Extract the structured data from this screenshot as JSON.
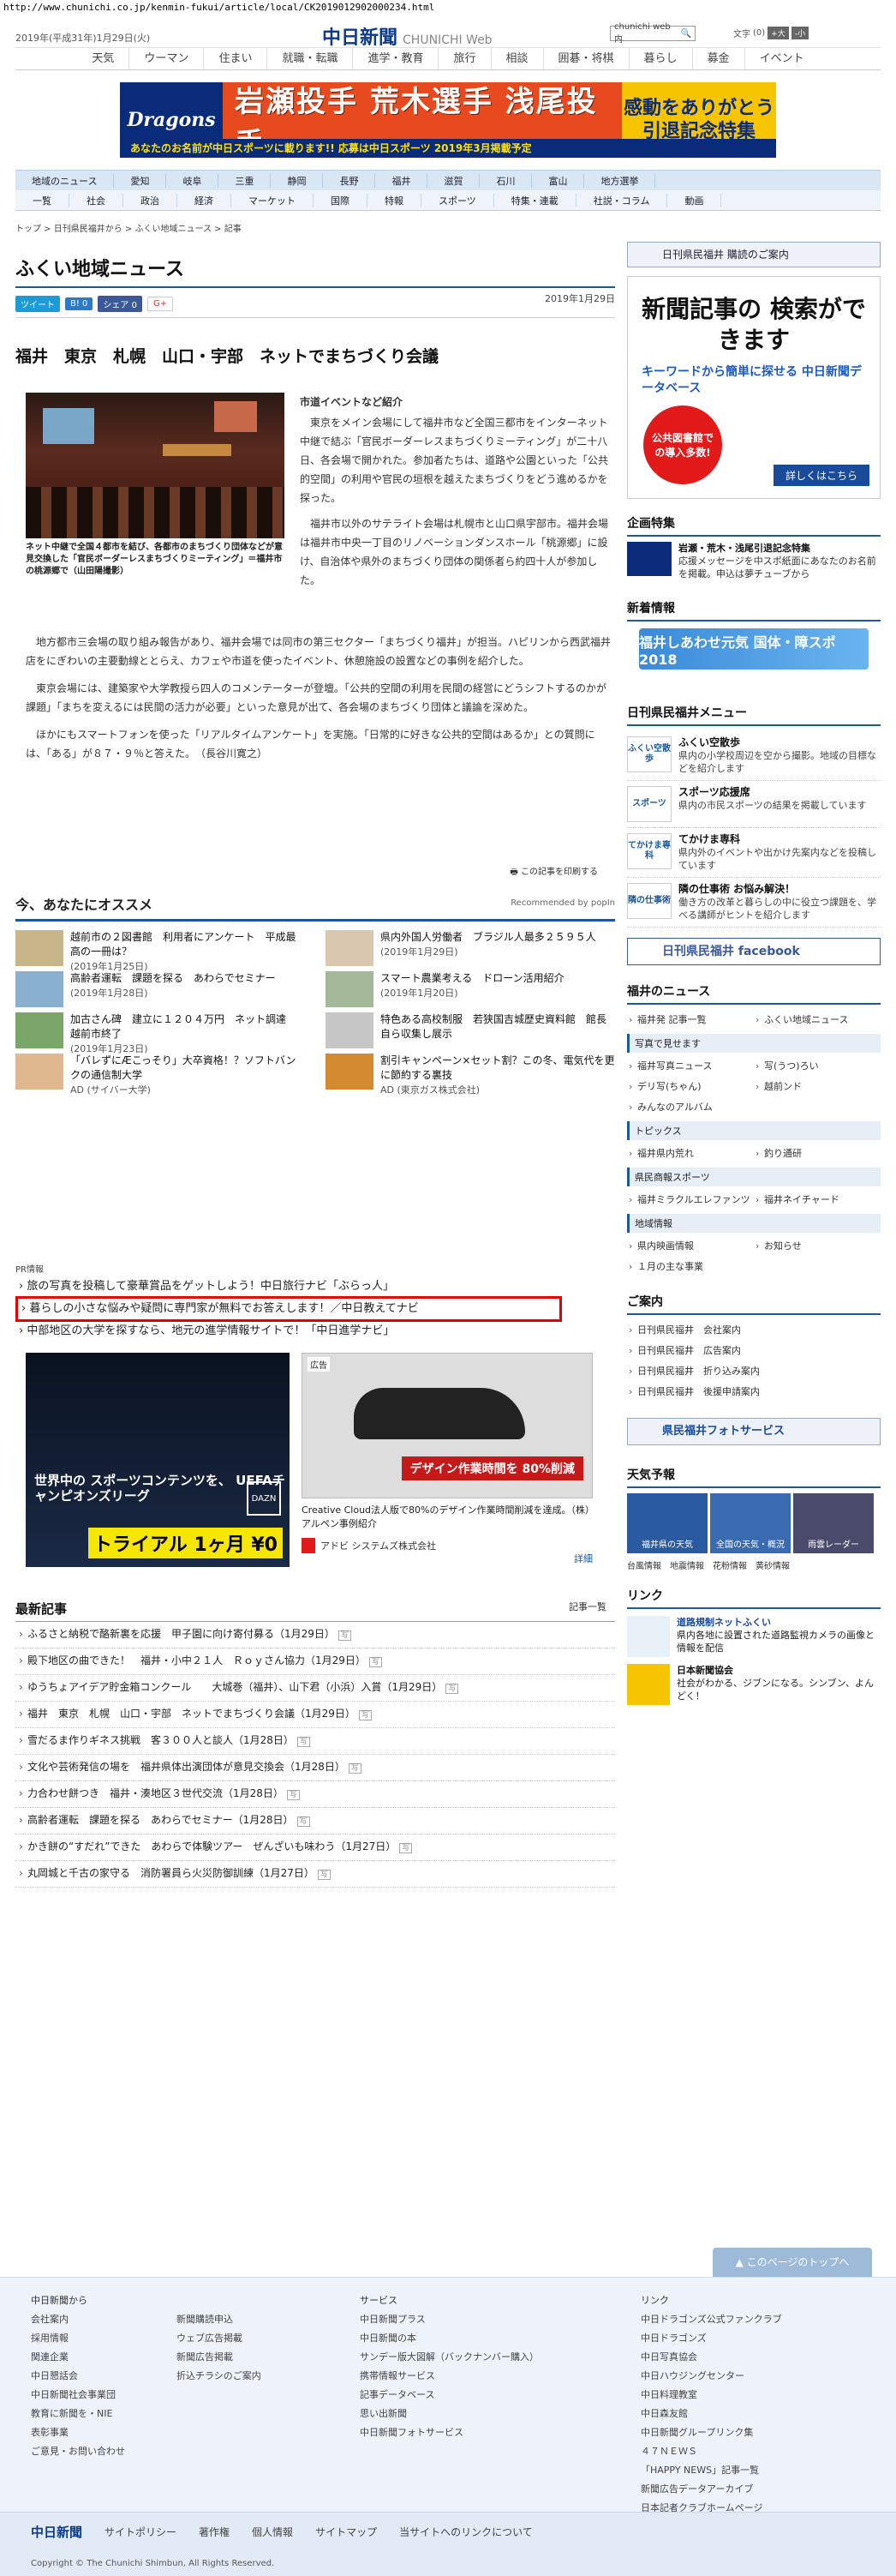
{
  "url": "http://www.chunichi.co.jp/kenmin-fukui/article/local/CK2019012902000234.html",
  "header": {
    "date": "2019年(平成31年)1月29日(火)",
    "logo": "中日新聞",
    "logo_web": "CHUNICHI Web",
    "search_placeholder": "chunichi web 内",
    "search_btn": "🔍",
    "font_label": "文字",
    "font_size": "(0)",
    "font_plus": "+大",
    "font_minus": "-小"
  },
  "gnav": [
    "天気",
    "ウーマン",
    "住まい",
    "就職・転職",
    "進学・教育",
    "旅行",
    "相談",
    "囲碁・将棋",
    "暮らし",
    "募金",
    "イベント"
  ],
  "banner": {
    "logo": "Dragons",
    "main": "岩瀬投手 荒木選手 浅尾投手",
    "right": "感動をありがとう 引退記念特集",
    "bottom": "あなたのお名前が中日スポーツに載ります!! 応募は中日スポーツ 2019年3月掲載予定"
  },
  "region_nav": [
    "地域のニュース",
    "愛知",
    "岐阜",
    "三重",
    "静岡",
    "長野",
    "福井",
    "滋賀",
    "石川",
    "富山",
    "地方選挙"
  ],
  "cat_nav": [
    "一覧",
    "社会",
    "政治",
    "経済",
    "マーケット",
    "国際",
    "特報",
    "スポーツ",
    "特集・連載",
    "社説・コラム",
    "動画"
  ],
  "breadcrumb": "トップ > 日刊県民福井から > ふくい地域ニュース > 記事",
  "page_title": "ふくい地域ニュース",
  "social": {
    "tweet": "ツイート",
    "hatena": "B! 0",
    "fb": "シェア 0",
    "gplus": "G+"
  },
  "article": {
    "date": "2019年1月29日",
    "title": "福井　東京　札幌　山口・宇部　ネットでまちづくり会議",
    "caption": "ネット中継で全国４都市を結び、各都市のまちづくり団体などが意見交換した「官民ボーダーレスまちづくりミーティング」＝福井市の桃源郷で（山田陽撮影）",
    "subhead": "市道イベントなど紹介",
    "p1": "東京をメイン会場にして福井市など全国三都市をインターネット中継で結ぶ「官民ボーダーレスまちづくりミーティング」が二十八日、各会場で開かれた。参加者たちは、道路や公園といった「公共的空間」の利用や官民の垣根を越えたまちづくりをどう進めるかを探った。",
    "p2": "福井市以外のサテライト会場は札幌市と山口県宇部市。福井会場は福井市中央一丁目のリノベーションダンスホール「桃源郷」に設け、自治体や県外のまちづくり団体の関係者ら約四十人が参加した。",
    "p3": "地方都市三会場の取り組み報告があり、福井会場では同市の第三セクター「まちづくり福井」が担当。ハピリンから西武福井店をにぎわいの主要動線ととらえ、カフェや市道を使ったイベント、休憩施設の設置などの事例を紹介した。",
    "p4": "東京会場には、建築家や大学教授ら四人のコメンテーターが登壇。「公共的空間の利用を民間の経営にどうシフトするのかが課題」「まちを変えるには民間の活力が必要」といった意見が出て、各会場のまちづくり団体と議論を深めた。",
    "p5": "ほかにもスマートフォンを使った「リアルタイムアンケート」を実施。「日常的に好きな公共的空間はあるか」との質問には、「ある」が８７・９％と答えた。　（長谷川寛之）",
    "print": "この記事を印刷する"
  },
  "recommend": {
    "title": "今、あなたにオススメ",
    "powered": "Recommended by popIn",
    "items": [
      {
        "t": "越前市の２図書館　利用者にアンケート　平成最高の一冊は？",
        "d": "(2019年1月25日)"
      },
      {
        "t": "県内外国人労働者　ブラジル人最多２５９５人",
        "d": "(2019年1月29日)"
      },
      {
        "t": "高齢者運転　課題を探る　あわらでセミナー",
        "d": "(2019年1月28日)"
      },
      {
        "t": "スマート農業考える　ドローン活用紹介",
        "d": "(2019年1月20日)"
      },
      {
        "t": "加古さん碑　建立に１２０４万円　ネット調達　越前市終了",
        "d": "(2019年1月23日)"
      },
      {
        "t": "特色ある高校制服　若狭国吉城歴史資料館　館長自ら収集し展示",
        "d": ""
      },
      {
        "t": "「バレずにÆこっそり」大卒資格！？ソフトバンクの通信制大学",
        "d": "AD (サイバー大学)"
      },
      {
        "t": "割引キャンペーン×セット割？この冬、電気代を更に節約する裏技",
        "d": "AD (東京ガス株式会社)"
      }
    ]
  },
  "pr": {
    "label": "PR情報",
    "items": [
      "旅の写真を投稿して豪華賞品をゲットしよう！中日旅行ナビ「ぶらっ人」",
      "暮らしの小さな悩みや疑問に専門家が無料でお答えします！／中日教えてナビ",
      "中部地区の大学を探すなら、地元の進学情報サイトで！「中日進学ナビ」"
    ]
  },
  "ad_left": {
    "t1": "世界中の スポーツコンテンツを、 UEFAチャンピオンズリーグ",
    "dazn": "DAZN",
    "trial": "トライアル 1ヶ月 ¥0"
  },
  "ad_right": {
    "tag": "広告",
    "msg": "デザイン作業時間を 80%削減",
    "desc": "Creative Cloud法人版で80%のデザイン作業時間削減を達成。（株）アルペン事例紹介",
    "adv": "アドビ システムズ株式会社",
    "detail": "詳細"
  },
  "latest": {
    "title": "最新記事",
    "list_link": "記事一覧",
    "items": [
      "ふるさと納税で酪新裏を応援　甲子園に向け寄付募る（1月29日）",
      "殿下地区の曲できた！　福井・小中２１人　Ｒｏｙさん協力（1月29日）",
      "ゆうちょアイデア貯金箱コンクール　　大城巻（福井）、山下君（小浜）入賞（1月29日）",
      "福井　東京　札幌　山口・宇部　ネットでまちづくり会議（1月29日）",
      "雪だるま作りギネス挑戦　客３００人と談人（1月28日）",
      "文化や芸術発信の場を　福井県体出演団体が意見交換会（1月28日）",
      "力合わせ餅つき　福井・湊地区３世代交流（1月28日）",
      "高齢者運転　課題を探る　あわらでセミナー（1月28日）",
      "かき餅の“すだれ”できた　あわらで体験ツアー　ぜんざいも味わう（1月27日）",
      "丸岡城と千古の家守る　消防署員ら火災防御訓練（1月27日）"
    ],
    "tag": "写"
  },
  "side": {
    "subscribe": "日刊県民福井 購読のご案内",
    "db_title": "新聞記事の 検索ができます",
    "db_sub": "キーワードから簡単に探せる 中日新聞データベース",
    "db_badge": "公共図書館での導入多数!",
    "db_btn": "詳しくはこちら",
    "kikaku": "企画特集",
    "kikaku_item": "岩瀬・荒木・浅尾引退記念特集",
    "kikaku_desc": "応援メッセージを中スポ紙面にあなたのお名前を掲載。申込は夢チューブから",
    "newinfo": "新着情報",
    "newinfo_banner": "福井しあわせ元気 国体・障スポ 2018",
    "menu": "日刊県民福井メニュー",
    "menu_items": [
      {
        "ic": "ふくい空散歩",
        "t": "ふくい空散歩",
        "d": "県内の小学校周辺を空から撮影。地域の目標などを紹介します"
      },
      {
        "ic": "スポーツ",
        "t": "スポーツ応援席",
        "d": "県内の市民スポーツの結果を掲載しています"
      },
      {
        "ic": "てかけま専科",
        "t": "てかけま専科",
        "d": "県内外のイベントや出かけ先案内などを投稿しています"
      },
      {
        "ic": "隣の仕事術",
        "t": "隣の仕事術 お悩み解決！",
        "d": "働き方の改革と暮らしの中に役立つ課題を、学べる講師がヒントを紹介します"
      }
    ],
    "fb": "日刊県民福井 facebook",
    "news": "福井のニュース",
    "news_items": [
      "福井発 記事一覧",
      "ふくい地域ニュース"
    ],
    "photo": "写真で見せます",
    "photo_items": [
      "福井写真ニュース",
      "写(うつ)ろい",
      "デリ写(ちゃん)",
      "越前ンド",
      "みんなのアルバム"
    ],
    "topics": "トピックス",
    "topics_items": [
      "福井県内荒れ",
      "釣り通研"
    ],
    "sports": "県民商報スポーツ",
    "sports_items": [
      "福井ミラクルエレファンツ",
      "福井ネイチャード"
    ],
    "local": "地域情報",
    "local_items": [
      "県内映画情報",
      "お知らせ",
      "１月の主な事業"
    ],
    "guide": "ご案内",
    "guide_items": [
      "日刊県民福井　会社案内",
      "日刊県民福井　広告案内",
      "日刊県民福井　折り込み案内",
      "日刊県民福井　後援申請案内"
    ],
    "photoservice": "県民福井フォトサービス",
    "weather": "天気予報",
    "weather_items": [
      "福井県の天気",
      "全国の天気・概況",
      "雨雲レーダー"
    ],
    "weather_links": [
      "台風情報",
      "地震情報",
      "花粉情報",
      "黄砂情報"
    ],
    "link": "リンク",
    "link1": "道路規制ネットふくい",
    "link1_d": "県内各地に設置された道路監視カメラの画像と情報を配信",
    "link2": "日本新聞協会",
    "link2_d": "社会がわかる、ジブンになる。シンブン、よんどく！"
  },
  "totop": "このページのトップへ",
  "footer": {
    "c1_head": "中日新聞から",
    "c1": [
      "会社案内",
      "採用情報",
      "関連企業",
      "中日懇話会",
      "中日新聞社会事業団",
      "教育に新聞を・NIE",
      "表彰事業",
      "ご意見・お問い合わせ"
    ],
    "c2": [
      "新聞購読申込",
      "ウェブ広告掲載",
      "新聞広告掲載",
      "折込チラシのご案内"
    ],
    "c3_head": "サービス",
    "c3": [
      "中日新聞プラス",
      "中日新聞の本",
      "サンデー版大図解（バックナンバー購入）",
      "携帯情報サービス",
      "記事データベース",
      "思い出新聞",
      "中日新聞フォトサービス"
    ],
    "c4_head": "リンク",
    "c4": [
      "中日ドラゴンズ公式ファンクラブ",
      "中日ドラゴンズ",
      "中日写真協会",
      "中日ハウジングセンター",
      "中日料理教室",
      "中日森友館",
      "中日新聞グループリンク集",
      "４７ＮＥＷＳ",
      "「HAPPY NEWS」記事一覧",
      "新聞広告データアーカイブ",
      "日本記者クラブホームページ"
    ],
    "links": [
      "サイトポリシー",
      "著作権",
      "個人情報",
      "サイトマップ",
      "当サイトへのリンクについて"
    ],
    "logo": "中日新聞",
    "copyright": "Copyright © The Chunichi Shimbun, All Rights Reserved."
  }
}
